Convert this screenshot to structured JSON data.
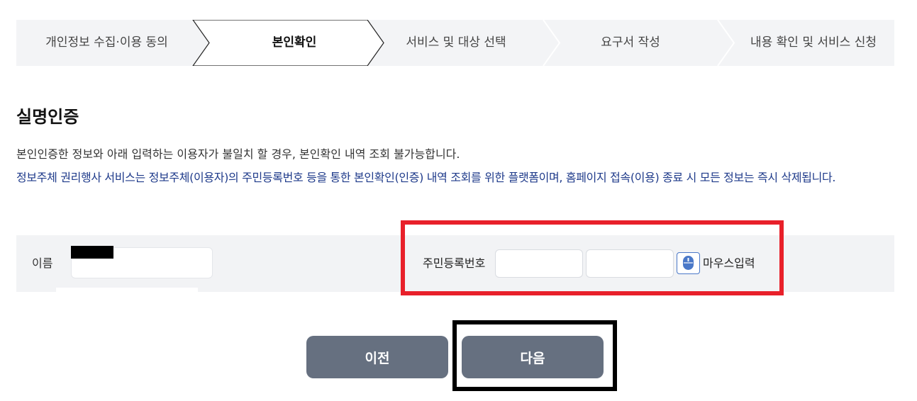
{
  "stepper": {
    "steps": [
      {
        "label": "개인정보 수집·이용 동의",
        "active": false
      },
      {
        "label": "본인확인",
        "active": true
      },
      {
        "label": "서비스 및 대상 선택",
        "active": false
      },
      {
        "label": "요구서 작성",
        "active": false
      },
      {
        "label": "내용 확인 및 서비스 신청",
        "active": false
      }
    ]
  },
  "section": {
    "title": "실명인증",
    "notice_1": "본인인증한 정보와 아래 입력하는 이용자가 불일치 할 경우, 본인확인 내역 조회 불가능합니다.",
    "notice_2": "정보주체 권리행사 서비스는 정보주체(이용자)의 주민등록번호 등을 통한 본인확인(인증) 내역 조회를 위한 플랫폼이며, 홈페이지 접속(이용) 종료 시 모든 정보는 즉시 삭제됩니다."
  },
  "form": {
    "name_label": "이름",
    "name_value": "",
    "rrn_label": "주민등록번호",
    "rrn_front_value": "",
    "rrn_back_value": "",
    "mouse_input_label": "마우스입력"
  },
  "buttons": {
    "prev_label": "이전",
    "next_label": "다음"
  },
  "colors": {
    "accent_notice": "#1e3a8a",
    "button_bg": "#667080",
    "highlight_red": "#e8202a",
    "highlight_black": "#000000"
  }
}
